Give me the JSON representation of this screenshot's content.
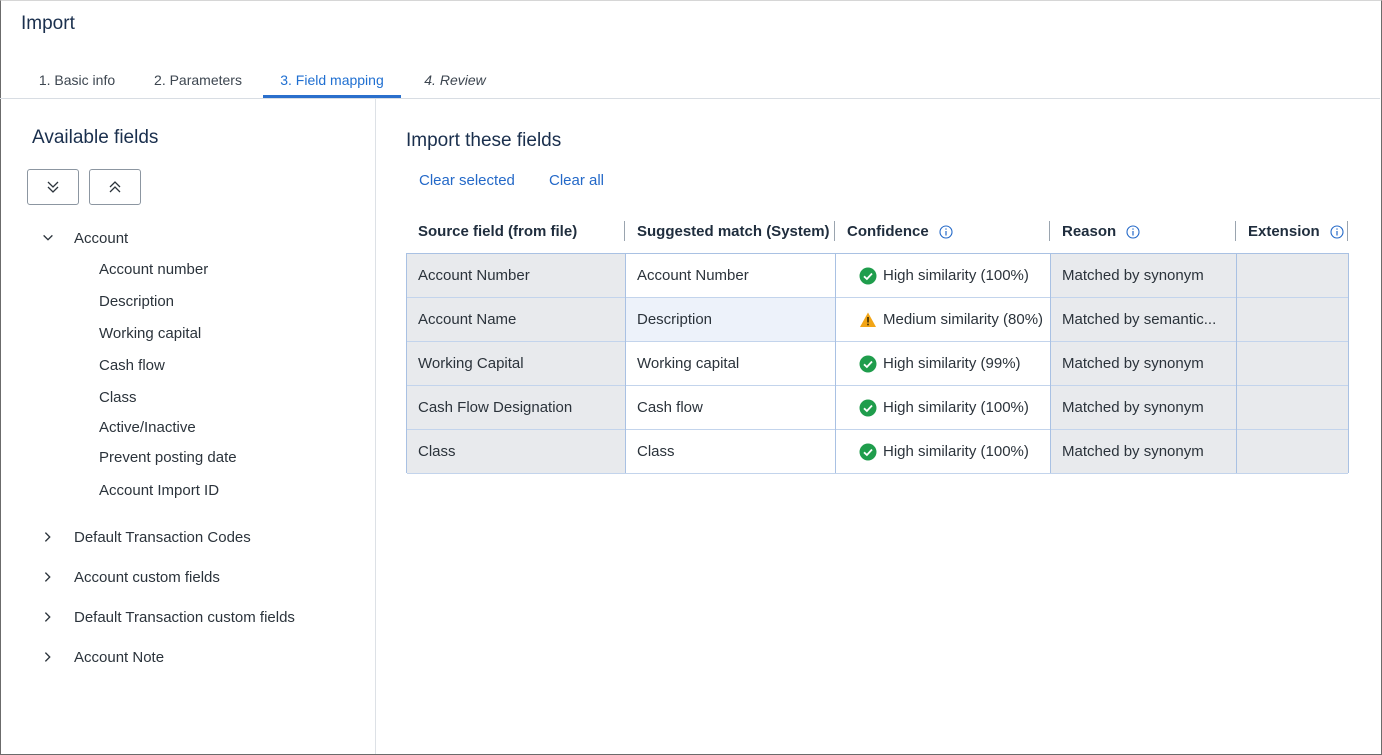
{
  "app": {
    "title": "Import"
  },
  "tabs": [
    {
      "label": "1. Basic info"
    },
    {
      "label": "2. Parameters"
    },
    {
      "label": "3. Field mapping"
    },
    {
      "label": "4. Review"
    }
  ],
  "left": {
    "title": "Available fields",
    "expand_all_icon": "double-chevron-down-icon",
    "collapse_all_icon": "double-chevron-up-icon",
    "tree": [
      {
        "label": "Account",
        "expanded": true,
        "children": [
          "Account number",
          "Description",
          "Working capital",
          "Cash flow",
          "Class",
          "Active/Inactive",
          "Prevent posting date",
          "Account Import ID"
        ]
      },
      {
        "label": "Default Transaction Codes",
        "expanded": false
      },
      {
        "label": "Account custom fields",
        "expanded": false
      },
      {
        "label": "Default Transaction custom fields",
        "expanded": false
      },
      {
        "label": "Account Note",
        "expanded": false
      }
    ]
  },
  "right": {
    "title": "Import these fields",
    "clear_selected": "Clear selected",
    "clear_all": "Clear all",
    "columns": [
      "Source field (from file)",
      "Suggested match (System)",
      "Confidence",
      "Reason",
      "Extension"
    ],
    "rows": [
      {
        "source": "Account Number",
        "match": "Account Number",
        "status": "high",
        "confidence": "High similarity (100%)",
        "reason": "Matched by synonym",
        "extension": ""
      },
      {
        "source": "Account Name",
        "match": "Description",
        "status": "medium",
        "confidence": "Medium similarity (80%)",
        "reason": "Matched by semantic...",
        "extension": ""
      },
      {
        "source": "Working Capital",
        "match": "Working capital",
        "status": "high",
        "confidence": "High similarity (99%)",
        "reason": "Matched by synonym",
        "extension": ""
      },
      {
        "source": "Cash Flow Designation",
        "match": "Cash flow",
        "status": "high",
        "confidence": "High similarity (100%)",
        "reason": "Matched by synonym",
        "extension": ""
      },
      {
        "source": "Class",
        "match": "Class",
        "status": "high",
        "confidence": "High similarity (100%)",
        "reason": "Matched by synonym",
        "extension": ""
      }
    ]
  },
  "colors": {
    "accent": "#2a6fcc",
    "success": "#1f9d4c",
    "warning": "#f2a516",
    "title": "#1a2f4d"
  }
}
